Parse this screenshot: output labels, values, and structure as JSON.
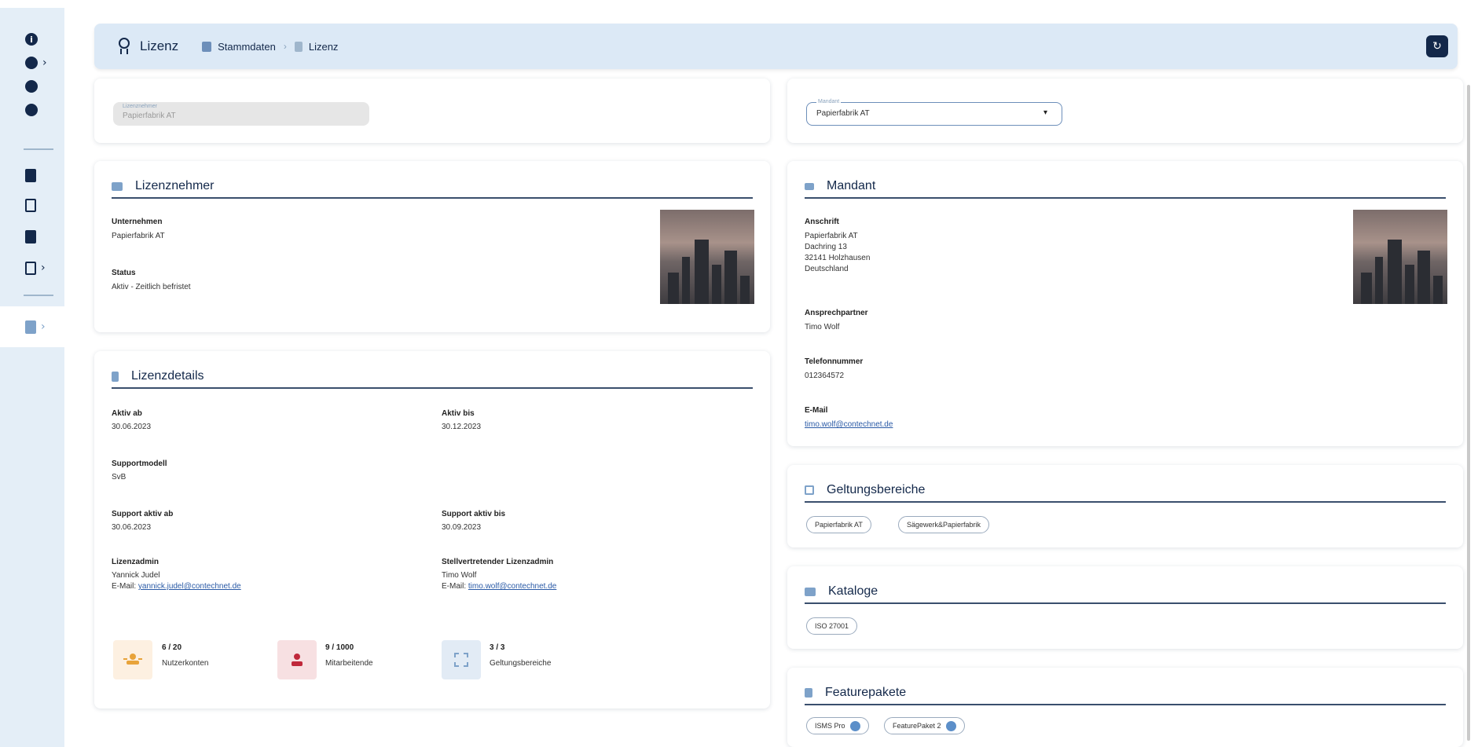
{
  "header": {
    "title": "Lizenz",
    "breadcrumb": [
      "Stammdaten",
      "Lizenz"
    ],
    "breadcrumb_sep": "›",
    "refresh_icon": "refresh-icon"
  },
  "sidebar": {
    "items": [
      {
        "icon": "info-circle-icon",
        "glyph": "i"
      },
      {
        "icon": "circle-expand-icon",
        "glyph": "●"
      },
      {
        "icon": "circle-icon",
        "glyph": "●"
      },
      {
        "icon": "circle-icon",
        "glyph": "●"
      },
      {
        "icon": "clipboard-icon"
      },
      {
        "icon": "briefcase-icon"
      },
      {
        "icon": "document-icon"
      },
      {
        "icon": "list-icon"
      },
      {
        "icon": "license-icon"
      }
    ]
  },
  "lizenznehmer_select": {
    "label": "Lizenznehmer",
    "value": "Papierfabrik AT"
  },
  "mandant_select": {
    "label": "Mandant",
    "value": "Papierfabrik AT"
  },
  "lizenznehmer": {
    "title": "Lizenznehmer",
    "unternehmen_label": "Unternehmen",
    "unternehmen": "Papierfabrik AT",
    "status_label": "Status",
    "status": "Aktiv - Zeitlich befristet"
  },
  "lizenzdetails": {
    "title": "Lizenzdetails",
    "aktiv_ab_label": "Aktiv ab",
    "aktiv_ab": "30.06.2023",
    "aktiv_bis_label": "Aktiv bis",
    "aktiv_bis": "30.12.2023",
    "supportmodell_label": "Supportmodell",
    "supportmodell": "SvB",
    "support_ab_label": "Support aktiv ab",
    "support_ab": "30.06.2023",
    "support_bis_label": "Support aktiv bis",
    "support_bis": "30.09.2023",
    "admin_label": "Lizenzadmin",
    "admin_name": "Yannick Judel",
    "admin_email_prefix": "E-Mail:",
    "admin_email": "yannick.judel@contechnet.de",
    "stv_label": "Stellvertretender Lizenzadmin",
    "stv_name": "Timo Wolf",
    "stv_email_prefix": "E-Mail:",
    "stv_email": "timo.wolf@contechnet.de",
    "stats": [
      {
        "value": "6 / 20",
        "label": "Nutzerkonten",
        "icon": "user-group-icon",
        "color": "#e8a33a",
        "bg": "#fdf0e1"
      },
      {
        "value": "9 / 1000",
        "label": "Mitarbeitende",
        "icon": "person-icon",
        "color": "#c0283b",
        "bg": "#f7e0e2"
      },
      {
        "value": "3 / 3",
        "label": "Geltungsbereiche",
        "icon": "scope-icon",
        "color": "#7ea2c9",
        "bg": "#e2ebf5"
      }
    ]
  },
  "mandant": {
    "title": "Mandant",
    "anschrift_label": "Anschrift",
    "anschrift": [
      "Papierfabrik AT",
      "Dachring 13",
      "32141 Holzhausen",
      "Deutschland"
    ],
    "ansprech_label": "Ansprechpartner",
    "ansprech": "Timo Wolf",
    "tel_label": "Telefonnummer",
    "tel": "012364572",
    "email_label": "E-Mail",
    "email": "timo.wolf@contechnet.de"
  },
  "geltungsbereiche": {
    "title": "Geltungsbereiche",
    "chips": [
      "Papierfabrik AT",
      "Sägewerk&Papierfabrik"
    ]
  },
  "kataloge": {
    "title": "Kataloge",
    "chips": [
      "ISO 27001"
    ]
  },
  "featurepakete": {
    "title": "Featurepakete",
    "chips": [
      "ISMS Pro",
      "FeaturePaket 2"
    ]
  }
}
